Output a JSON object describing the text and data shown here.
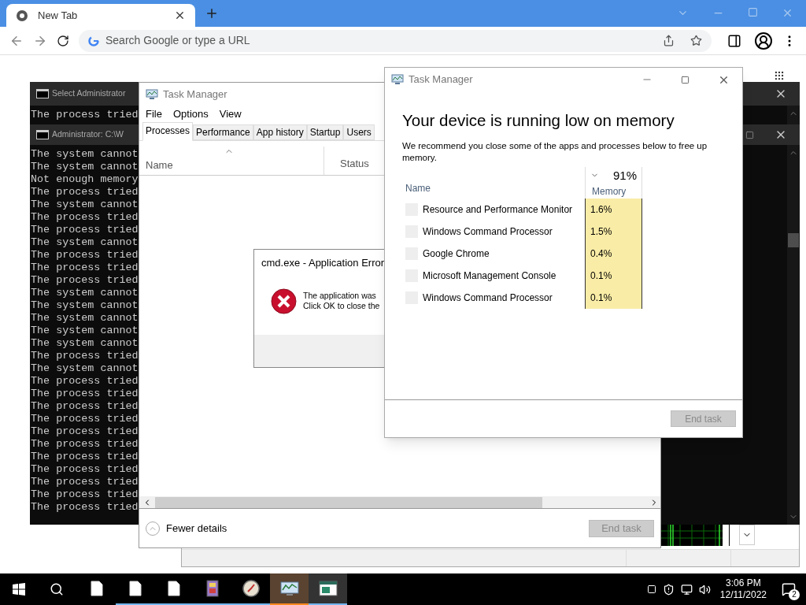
{
  "browser": {
    "tab": {
      "title": "New Tab"
    },
    "omnibox": {
      "placeholder": "Search Google or type a URL"
    }
  },
  "console_windows": [
    {
      "title": "Select Administrator",
      "lines": [
        "The process tried"
      ]
    },
    {
      "title": "Administrator: C:\\W",
      "lines": [
        "The system cannot",
        "The system cannot",
        "Not enough memory",
        "The process tried",
        "The system cannot",
        "The process tried",
        "The process tried",
        "The system cannot",
        "The process tried",
        "The process tried",
        "The process tried",
        "The system cannot",
        "The system cannot",
        "The system cannot",
        "The system cannot",
        "The system cannot",
        "The process tried",
        "The system cannot",
        "The process tried",
        "The process tried",
        "The process tried",
        "The process tried",
        "The process tried",
        "The process tried",
        "The process tried",
        "The process tried",
        "The process tried",
        "The process tried",
        "The process tried"
      ]
    }
  ],
  "task_manager": {
    "title": "Task Manager",
    "menu": [
      "File",
      "Options",
      "View"
    ],
    "tabs": [
      {
        "label": "Processes",
        "selected": true
      },
      {
        "label": "Performance",
        "selected": false
      },
      {
        "label": "App history",
        "selected": false
      },
      {
        "label": "Startup",
        "selected": false
      },
      {
        "label": "Users",
        "selected": false
      }
    ],
    "columns": [
      "Name",
      "Status"
    ],
    "toggle": "Fewer details",
    "button": {
      "label": "End task",
      "disabled": true
    }
  },
  "error_dialog": {
    "title": "cmd.exe - Application Error",
    "message": [
      "The application was",
      "Click OK to close the"
    ]
  },
  "memory_alert": {
    "title": "Task Manager",
    "heading": "Your device is running low on memory",
    "description": "We recommend you close some of the apps and processes below to free up memory.",
    "name_column": "Name",
    "memory_total": "91%",
    "memory_column": "Memory",
    "rows": [
      {
        "name": "Resource and Performance Monitor",
        "memory": "1.6%",
        "checked": false
      },
      {
        "name": "Windows Command Processor",
        "memory": "1.5%",
        "checked": false
      },
      {
        "name": "Google Chrome",
        "memory": "0.4%",
        "checked": false
      },
      {
        "name": "Microsoft Management Console",
        "memory": "0.1%",
        "checked": false
      },
      {
        "name": "Windows Command Processor",
        "memory": "0.1%",
        "checked": false
      }
    ],
    "button": {
      "label": "End task",
      "disabled": true
    }
  },
  "taskbar": {
    "apps": [
      {
        "kind": "file",
        "open": false,
        "active": false
      },
      {
        "kind": "file",
        "open": true,
        "active": false
      },
      {
        "kind": "file",
        "open": true,
        "active": false
      },
      {
        "kind": "archive",
        "open": true,
        "active": false
      },
      {
        "kind": "compass",
        "open": true,
        "active": false
      },
      {
        "kind": "monitor",
        "open": true,
        "active": true
      },
      {
        "kind": "console",
        "open": true,
        "active": false
      }
    ],
    "clock": {
      "time": "3:06 PM",
      "date": "12/11/2022"
    },
    "notifications": "2"
  }
}
